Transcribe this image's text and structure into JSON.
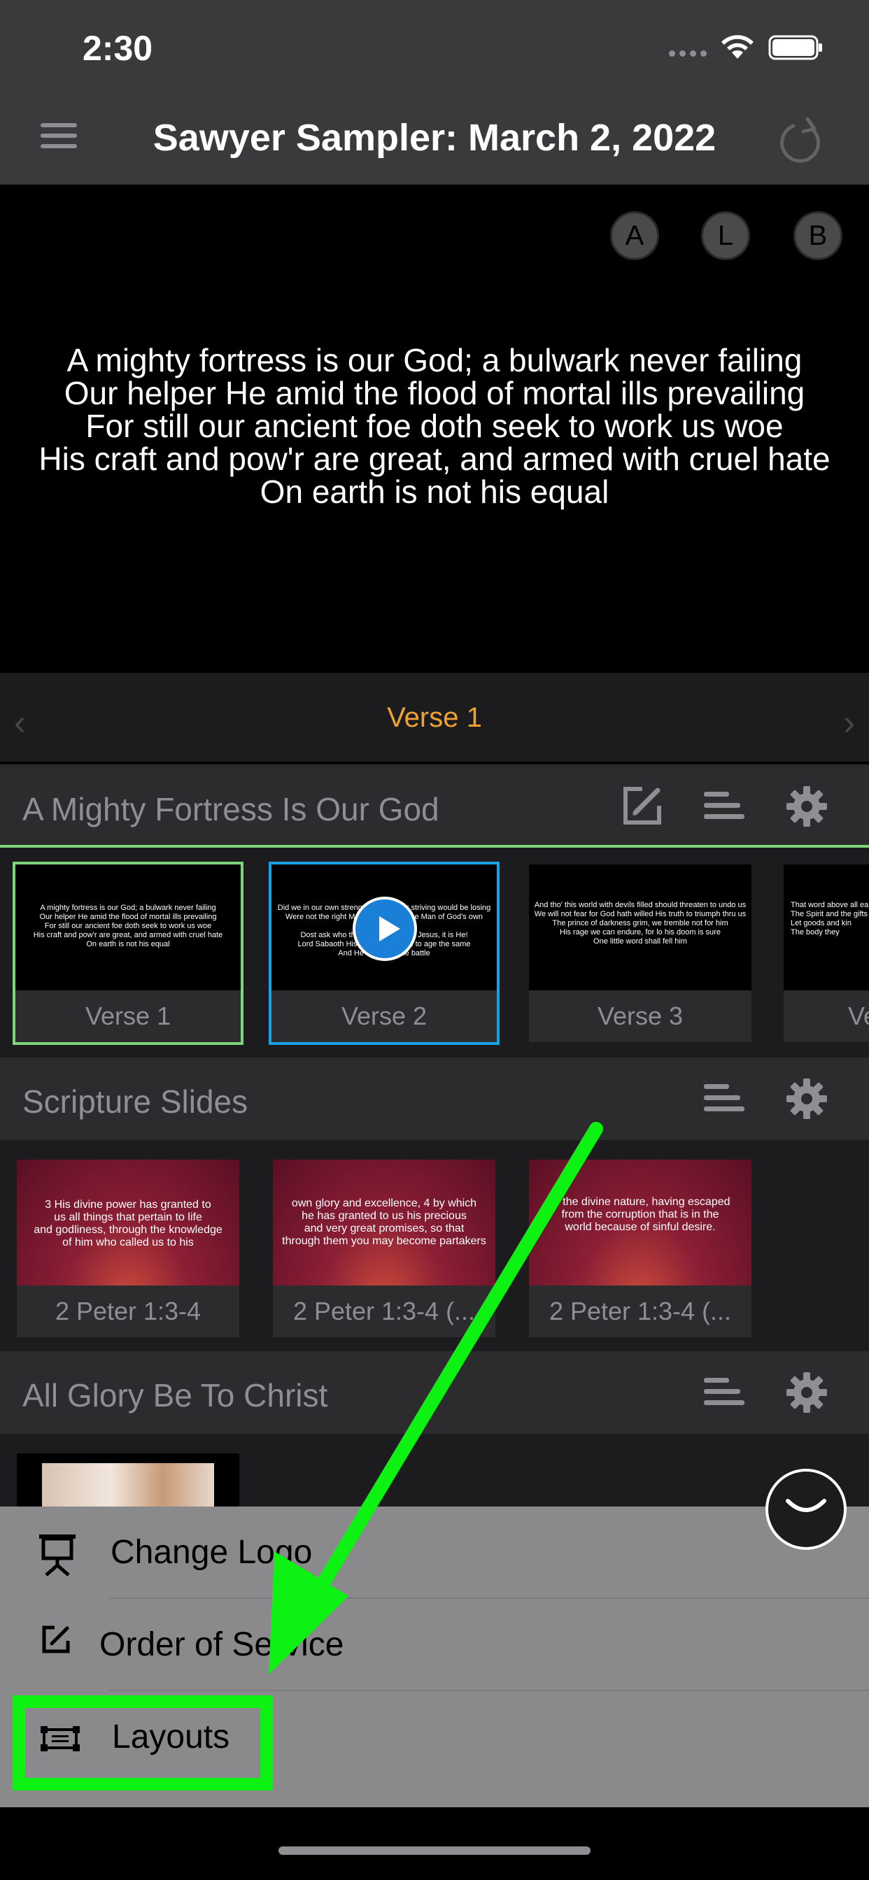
{
  "status_bar": {
    "time": "2:30"
  },
  "nav": {
    "title": "Sawyer Sampler: March 2, 2022"
  },
  "preview": {
    "badges": [
      "A",
      "L",
      "B"
    ],
    "lyrics": [
      "A mighty fortress is our God; a bulwark never failing",
      "Our helper He amid the flood of mortal ills prevailing",
      "For still our ancient foe doth seek to work us woe",
      "His craft and pow'r are great, and armed with cruel hate",
      "On earth is not his equal"
    ]
  },
  "verse_bar": {
    "current": "Verse 1"
  },
  "sections": [
    {
      "title": "A Mighty Fortress Is Our God",
      "slides": [
        {
          "caption": "Verse 1",
          "state": "live",
          "text": [
            "A mighty fortress is our God; a bulwark never failing",
            "Our helper He amid the flood of mortal ills prevailing",
            "For still our ancient foe doth seek to work us woe",
            "His craft and pow'r are great, and armed with cruel hate",
            "On earth is not his equal"
          ]
        },
        {
          "caption": "Verse 2",
          "state": "selected",
          "text": [
            "Did we in our own strength confide our striving would be losing",
            "Were not the right Man on our side, the Man of God's own choosing",
            "Dost ask who that may be? Christ Jesus, it is He!",
            "Lord Sabaoth His name, from age to age the same",
            "And He must win the battle"
          ]
        },
        {
          "caption": "Verse 3",
          "state": "normal",
          "text": [
            "And tho' this world with devils filled should threaten to undo us",
            "We will not fear for God hath willed His truth to triumph thru us",
            "The prince of darkness grim, we tremble not for him",
            "His rage we can endure, for lo his doom is sure",
            "One little word shall fell him"
          ]
        },
        {
          "caption": "Ve",
          "state": "normal",
          "text": [
            "That word above all earthly",
            "The Spirit and the gifts",
            "Let goods and kin",
            "The body they"
          ]
        }
      ]
    },
    {
      "title": "Scripture Slides",
      "slides": [
        {
          "caption": "2 Peter 1:3-4",
          "text": [
            "3 His divine power has granted to",
            "us all things that pertain to life",
            "and godliness, through the knowledge",
            "of him who called us to his"
          ]
        },
        {
          "caption": "2 Peter 1:3-4 (...",
          "text": [
            "own glory and excellence, 4 by which",
            "he has granted to us his precious",
            "and very great promises, so that",
            "through them you may become partakers"
          ]
        },
        {
          "caption": "2 Peter 1:3-4 (...",
          "text": [
            "of the divine nature, having escaped",
            "from the corruption that is in the",
            "world because of sinful desire."
          ]
        }
      ]
    },
    {
      "title": "All Glory Be To Christ"
    }
  ],
  "menu": {
    "items": [
      {
        "label": "Change Logo",
        "icon": "presentation-icon"
      },
      {
        "label": "Order of Service",
        "icon": "edit-icon"
      },
      {
        "label": "Layouts",
        "icon": "layout-icon"
      }
    ]
  },
  "colors": {
    "accent_orange": "#f0a22e",
    "live_green": "#7bd67a",
    "selected_blue": "#1aa0e6",
    "annotation_green": "#0df212"
  }
}
